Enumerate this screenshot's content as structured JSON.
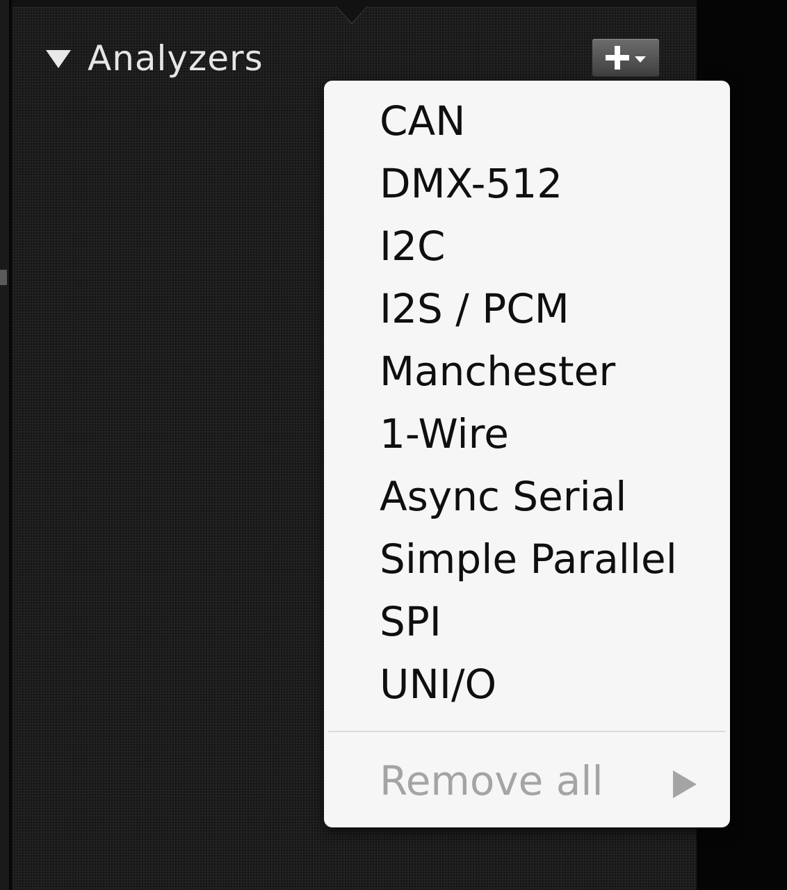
{
  "panel": {
    "section_title": "Analyzers"
  },
  "menu": {
    "items": [
      {
        "label": "CAN"
      },
      {
        "label": "DMX-512"
      },
      {
        "label": "I2C"
      },
      {
        "label": "I2S / PCM"
      },
      {
        "label": "Manchester"
      },
      {
        "label": "1-Wire"
      },
      {
        "label": "Async Serial"
      },
      {
        "label": "Simple Parallel"
      },
      {
        "label": "SPI"
      },
      {
        "label": "UNI/O"
      }
    ],
    "remove_all_label": "Remove all"
  },
  "icons": {
    "disclosure": "disclosure-triangle-down-icon",
    "add": "plus-icon",
    "dropdown": "chevron-down-icon",
    "submenu": "submenu-arrow-icon"
  },
  "colors": {
    "panel_background": "#1c1c1c",
    "menu_background": "#f6f6f6",
    "menu_text": "#0f0f0f",
    "disabled_text": "#a4a4a4"
  }
}
